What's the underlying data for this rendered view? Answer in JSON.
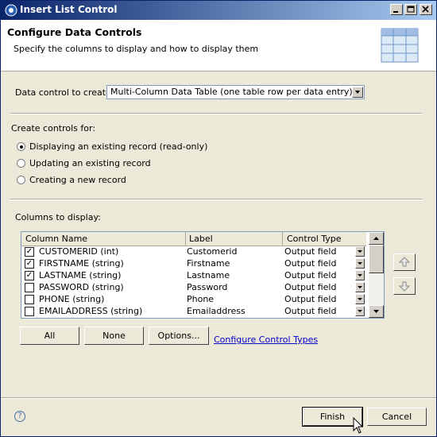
{
  "window": {
    "title": "Insert List Control"
  },
  "header": {
    "title": "Configure Data Controls",
    "description": "Specify the columns to display and how to display them"
  },
  "data_control": {
    "label": "Data control to create:",
    "selected": "Multi-Column Data Table (one table row per data entry)"
  },
  "create_controls": {
    "label": "Create controls for:",
    "options": [
      {
        "label": "Displaying an existing record (read-only)",
        "selected": true
      },
      {
        "label": "Updating an existing record",
        "selected": false
      },
      {
        "label": "Creating a new record",
        "selected": false
      }
    ]
  },
  "columns": {
    "label": "Columns to display:",
    "headers": [
      "Column Name",
      "Label",
      "Control Type"
    ],
    "rows": [
      {
        "name": "CUSTOMERID (int)",
        "label": "Customerid",
        "type": "Output field",
        "checked": true
      },
      {
        "name": "FIRSTNAME (string)",
        "label": "Firstname",
        "type": "Output field",
        "checked": true
      },
      {
        "name": "LASTNAME (string)",
        "label": "Lastname",
        "type": "Output field",
        "checked": true
      },
      {
        "name": "PASSWORD (string)",
        "label": "Password",
        "type": "Output field",
        "checked": false
      },
      {
        "name": "PHONE (string)",
        "label": "Phone",
        "type": "Output field",
        "checked": false
      },
      {
        "name": "EMAILADDRESS (string)",
        "label": "Emailaddress",
        "type": "Output field",
        "checked": false
      }
    ]
  },
  "buttons": {
    "all": "All",
    "none": "None",
    "options": "Options...",
    "configure_link": "Configure Control Types",
    "finish": "Finish",
    "cancel": "Cancel",
    "help": "?"
  }
}
